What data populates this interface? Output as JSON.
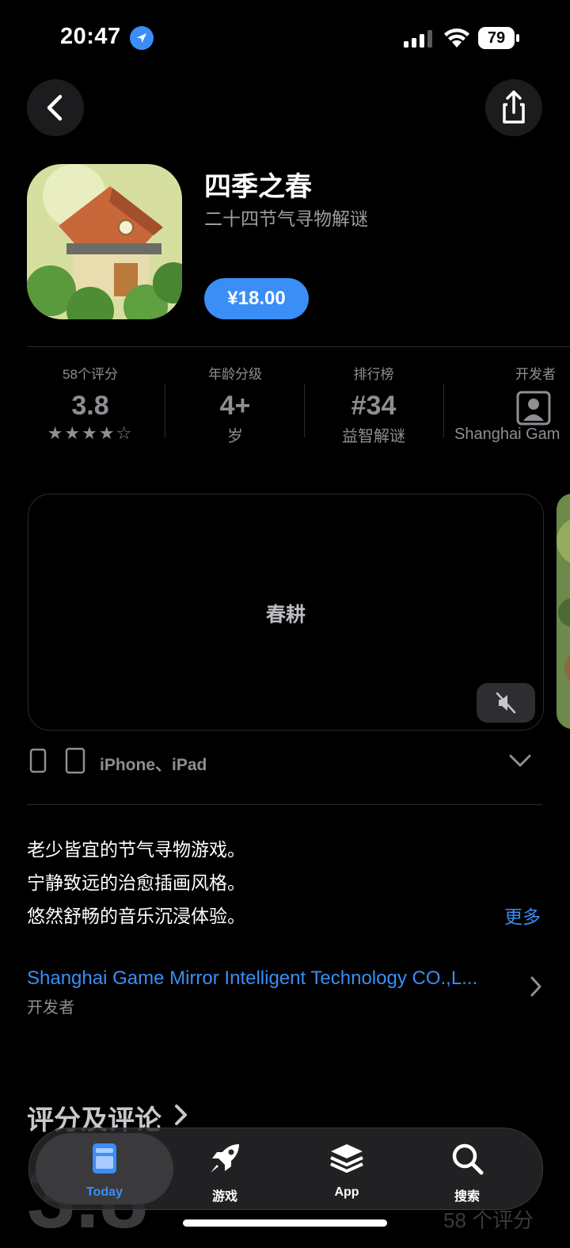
{
  "status_bar": {
    "time": "20:47",
    "battery": "79"
  },
  "app": {
    "title": "四季之春",
    "subtitle": "二十四节气寻物解谜",
    "price": "¥18.00"
  },
  "stats": {
    "ratings": {
      "label": "58个评分",
      "value": "3.8",
      "stars": "★★★★☆"
    },
    "age": {
      "label": "年龄分级",
      "value": "4+",
      "sub": "岁"
    },
    "chart": {
      "label": "排行榜",
      "value": "#34",
      "sub": "益智解谜"
    },
    "developer": {
      "label": "开发者",
      "sub": "Shanghai Gam"
    }
  },
  "media": {
    "caption": "春耕"
  },
  "devices": {
    "text": "iPhone、iPad"
  },
  "description": {
    "lines": [
      "老少皆宜的节气寻物游戏。",
      "宁静致远的治愈插画风格。",
      "悠然舒畅的音乐沉浸体验。"
    ],
    "more": "更多"
  },
  "developer_link": {
    "name": "Shanghai Game Mirror Intelligent Technology CO.,L...",
    "role": "开发者"
  },
  "ratings_section": {
    "title": "评分及评论",
    "big_value": "3.8",
    "count": "58 个评分"
  },
  "tabbar": {
    "tabs": [
      {
        "label": "Today",
        "icon": "today-icon",
        "active": true
      },
      {
        "label": "游戏",
        "icon": "rocket-icon",
        "active": false
      },
      {
        "label": "App",
        "icon": "layers-icon",
        "active": false
      },
      {
        "label": "搜索",
        "icon": "search-icon",
        "active": false
      }
    ]
  },
  "colors": {
    "accent": "#3a8ef6",
    "background": "#000000",
    "secondary_text": "#8e8e93"
  }
}
